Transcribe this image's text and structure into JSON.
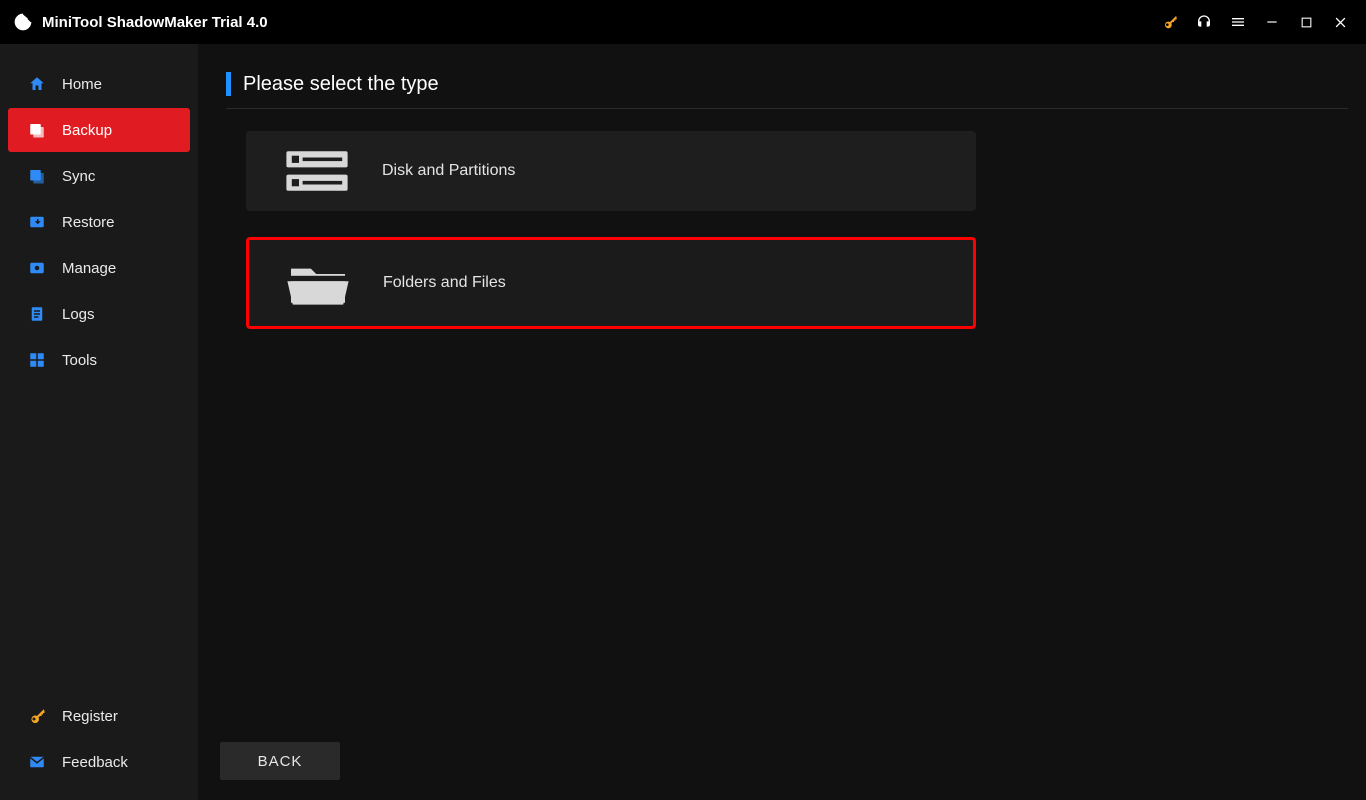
{
  "app": {
    "title": "MiniTool ShadowMaker Trial 4.0"
  },
  "titlebar": {
    "icons": {
      "key": "key-icon",
      "headset": "headset-icon",
      "menu": "menu-icon",
      "minimize": "minimize-icon",
      "maximize": "maximize-icon",
      "close": "close-icon"
    }
  },
  "sidebar": {
    "items": [
      {
        "label": "Home"
      },
      {
        "label": "Backup"
      },
      {
        "label": "Sync"
      },
      {
        "label": "Restore"
      },
      {
        "label": "Manage"
      },
      {
        "label": "Logs"
      },
      {
        "label": "Tools"
      }
    ],
    "active_index": 1,
    "bottom": [
      {
        "label": "Register"
      },
      {
        "label": "Feedback"
      }
    ]
  },
  "page": {
    "heading": "Please select the type",
    "options": [
      {
        "label": "Disk and Partitions",
        "highlight": false
      },
      {
        "label": "Folders and Files",
        "highlight": true
      }
    ],
    "back_label": "BACK"
  }
}
